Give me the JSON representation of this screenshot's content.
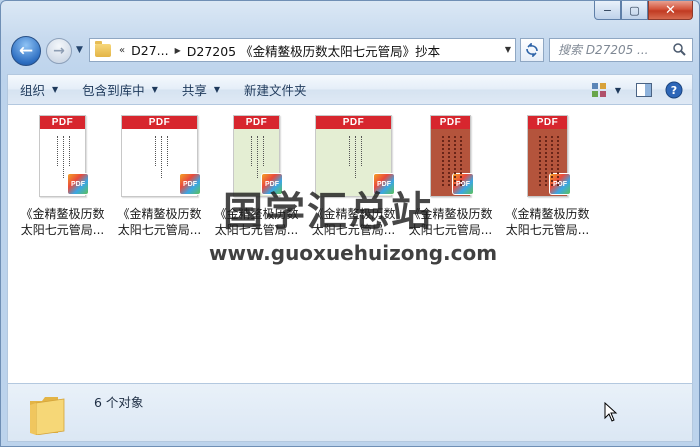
{
  "window": {
    "caption": {
      "minimize": "−",
      "maximize": "▢",
      "close": "✕"
    }
  },
  "address": {
    "overflow": "«",
    "crumbs": [
      "D27...",
      "D27205 《金精鳌极历数太阳七元管局》抄本"
    ]
  },
  "search": {
    "placeholder": "搜索 D27205 ..."
  },
  "toolbar": {
    "organize": "组织",
    "include_library": "包含到库中",
    "share": "共享",
    "new_folder": "新建文件夹"
  },
  "files": [
    {
      "line1": "《金精鳌极历数",
      "line2": "太阳七元管局...",
      "tone": "#ffffff"
    },
    {
      "line1": "《金精鳌极历数",
      "line2": "太阳七元管局...",
      "tone": "#ffffff"
    },
    {
      "line1": "《金精鳌极历数",
      "line2": "太阳七元管局...",
      "tone": "#e4eed3"
    },
    {
      "line1": "《金精鳌极历数",
      "line2": "太阳七元管局...",
      "tone": "#e4eed3"
    },
    {
      "line1": "《金精鳌极历数",
      "line2": "太阳七元管局...",
      "tone": "#b4543c"
    },
    {
      "line1": "《金精鳌极历数",
      "line2": "太阳七元管局...",
      "tone": "#b4543c"
    }
  ],
  "pdf_band_label": "PDF",
  "badge_label": "PDF",
  "watermark": {
    "cn": "国学汇总站",
    "url": "www.guoxuehuizong.com"
  },
  "status": {
    "count": "6 个对象"
  },
  "colors": {
    "pdf_red": "#d7262e",
    "accent": "#2e6fc2"
  }
}
